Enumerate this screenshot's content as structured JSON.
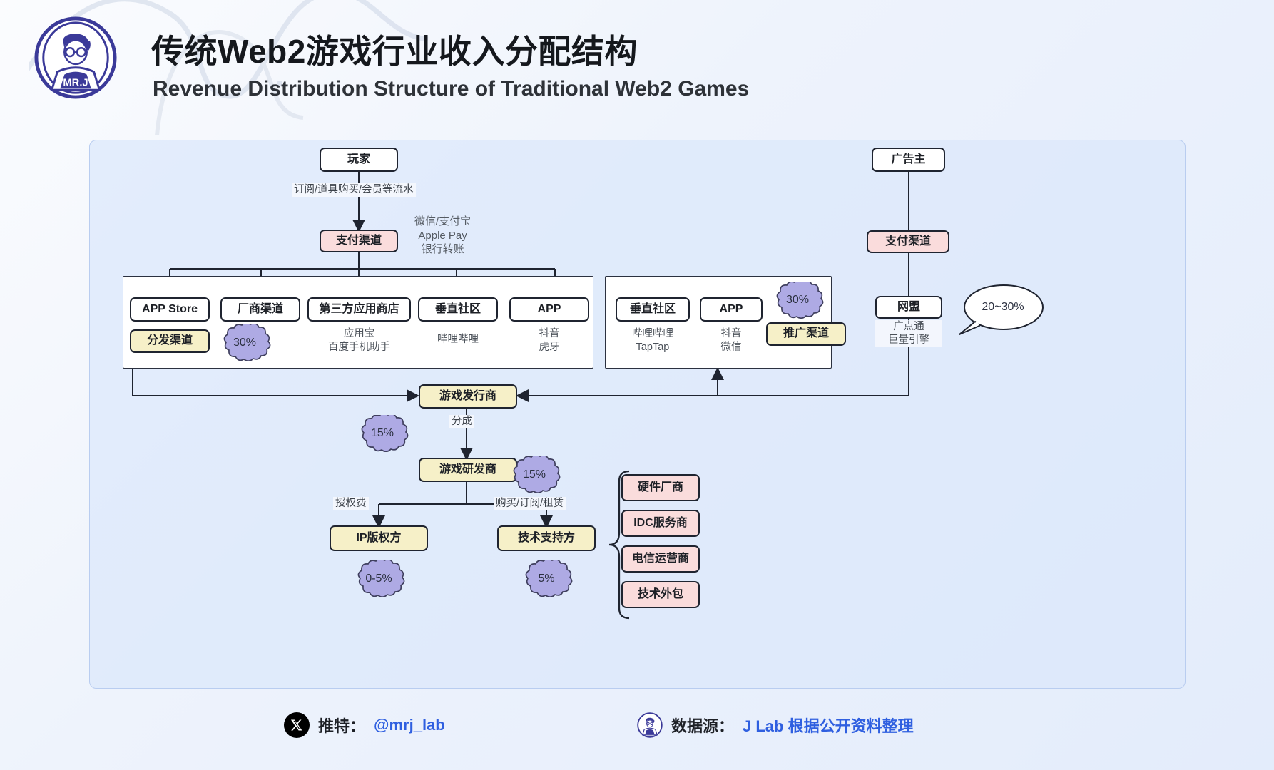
{
  "header": {
    "title_cn": "传统Web2游戏行业收入分配结构",
    "title_en": "Revenue Distribution Structure of Traditional Web2 Games",
    "logo_alt": "mr-j-logo"
  },
  "diagram": {
    "player": "玩家",
    "player_flow_label": "订阅/道具购买/会员等流水",
    "payment_channel": "支付渠道",
    "payment_methods": "微信/支付宝\nApple Pay\n银行转账",
    "payment_methods_lines": [
      "微信/支付宝",
      "Apple Pay",
      "银行转账"
    ],
    "distribution_group": {
      "tag": "分发渠道",
      "percent": "30%",
      "channels": [
        {
          "name": "APP Store",
          "sub": ""
        },
        {
          "name": "厂商渠道",
          "sub": ""
        },
        {
          "name": "第三方应用商店",
          "sub": "应用宝\n百度手机助手",
          "sub_lines": [
            "应用宝",
            "百度手机助手"
          ]
        },
        {
          "name": "垂直社区",
          "sub": "哔哩哔哩",
          "sub_lines": [
            "哔哩哔哩"
          ]
        },
        {
          "name": "APP",
          "sub": "抖音\n虎牙",
          "sub_lines": [
            "抖音",
            "虎牙"
          ]
        }
      ]
    },
    "promotion_group": {
      "tag": "推广渠道",
      "percent": "30%",
      "channels": [
        {
          "name": "垂直社区",
          "sub_lines": [
            "哔哩哔哩",
            "TapTap"
          ]
        },
        {
          "name": "APP",
          "sub_lines": [
            "抖音",
            "微信"
          ]
        }
      ]
    },
    "advertiser": "广告主",
    "ad_payment_channel": "支付渠道",
    "ad_network": "网盟",
    "ad_network_sub_lines": [
      "广点通",
      "巨量引擎"
    ],
    "ad_network_percent": "20~30%",
    "publisher": "游戏发行商",
    "publisher_percent": "15%",
    "split_label": "分成",
    "developer": "游戏研发商",
    "developer_percent": "15%",
    "license_fee_label": "授权费",
    "purchase_label": "购买/订阅/租赁",
    "ip_holder": "IP版权方",
    "ip_percent": "0-5%",
    "tech_support": "技术支持方",
    "tech_percent": "5%",
    "vendors": [
      "硬件厂商",
      "IDC服务商",
      "电信运营商",
      "技术外包"
    ]
  },
  "footer": {
    "twitter_label": "推特：",
    "twitter_handle": "@mrj_lab",
    "source_label": "数据源：",
    "source_value": "J Lab 根据公开资料整理"
  },
  "colors": {
    "pink": "#fadcdc",
    "yellow": "#f6f0c8",
    "cloud_purple": "#aeaae4",
    "link_blue": "#2f5fe0",
    "canvas_blue": "#dbe7fb",
    "stroke": "#1f2430"
  }
}
